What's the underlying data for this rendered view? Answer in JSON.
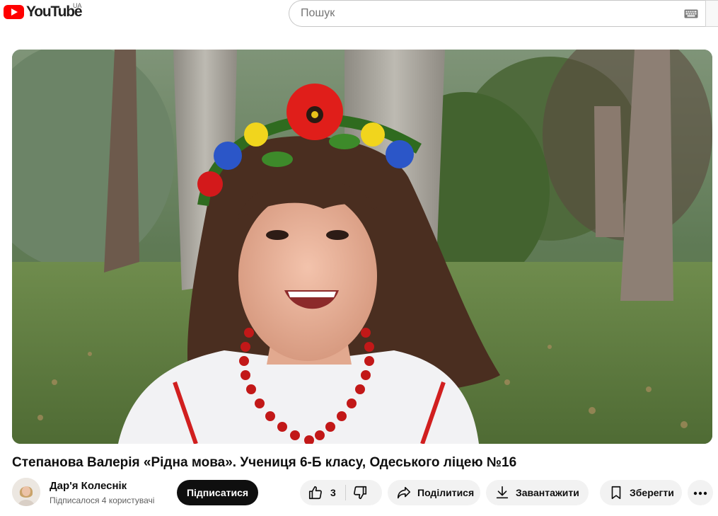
{
  "header": {
    "logo_text": "YouTube",
    "country_code": "UA",
    "search_placeholder": "Пошук",
    "search_value": ""
  },
  "icons": {
    "logo": "youtube-play-icon",
    "keyboard": "keyboard-icon",
    "like": "thumb-up-icon",
    "dislike": "thumb-down-icon",
    "share": "share-arrow-icon",
    "download": "download-icon",
    "save": "bookmark-icon",
    "more": "more-horizontal-icon"
  },
  "colors": {
    "brand_red": "#ff0000",
    "subscribe_bg": "#0f0f0f",
    "pill_bg": "#f2f2f2"
  },
  "video": {
    "title": "Степанова Валерія «Рідна мова». Учениця 6-Б класу, Одеського ліцею №16"
  },
  "channel": {
    "name": "Дар'я Колеснік",
    "subscribers": "Підписалося 4 користувачі",
    "subscribe_label": "Підписатися"
  },
  "actions": {
    "like_count": "3",
    "share_label": "Поділитися",
    "download_label": "Завантажити",
    "save_label": "Зберегти"
  }
}
